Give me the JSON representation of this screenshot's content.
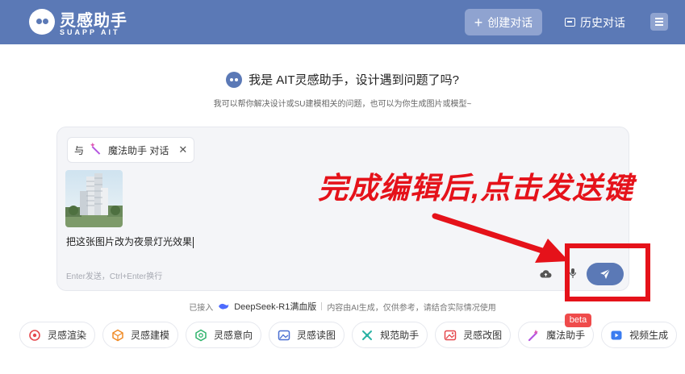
{
  "header": {
    "logo_title": "灵感助手",
    "logo_subtitle": "SUAPP AIT",
    "new_chat_label": "创建对话",
    "history_label": "历史对话"
  },
  "greeting": {
    "title": "我是 AIT灵感助手，设计遇到问题了吗?",
    "subtitle": "我可以帮你解决设计或SU建模相关的问题，也可以为你生成图片或模型~"
  },
  "composer": {
    "chip_prefix": "与",
    "chip_label": "魔法助手 对话",
    "chip_close": "✕",
    "prompt": "把这张图片改为夜景灯光效果",
    "placeholder": "Enter发送，Ctrl+Enter换行"
  },
  "annotation": {
    "text": "完成编辑后,点击发送键"
  },
  "powered_by": {
    "prefix": "已接入",
    "model": "DeepSeek-R1满血版",
    "disclaimer": "内容由AI生成，仅供参考，请结合实际情况使用"
  },
  "tools": [
    {
      "label": "灵感渲染",
      "icon": "render-icon",
      "color": "#e5484d"
    },
    {
      "label": "灵感建模",
      "icon": "model-icon",
      "color": "#f08a24"
    },
    {
      "label": "灵感意向",
      "icon": "intent-icon",
      "color": "#2fb36b"
    },
    {
      "label": "灵感读图",
      "icon": "read-image-icon",
      "color": "#4a6fd1"
    },
    {
      "label": "规范助手",
      "icon": "spec-icon",
      "color": "#2bb3a5"
    },
    {
      "label": "灵感改图",
      "icon": "edit-image-icon",
      "color": "#e5484d"
    },
    {
      "label": "魔法助手",
      "icon": "magic-wand-icon",
      "color": "#b455e0"
    },
    {
      "label": "视频生成",
      "icon": "video-icon",
      "color": "#3b7cf0"
    }
  ],
  "beta_badge": "beta"
}
